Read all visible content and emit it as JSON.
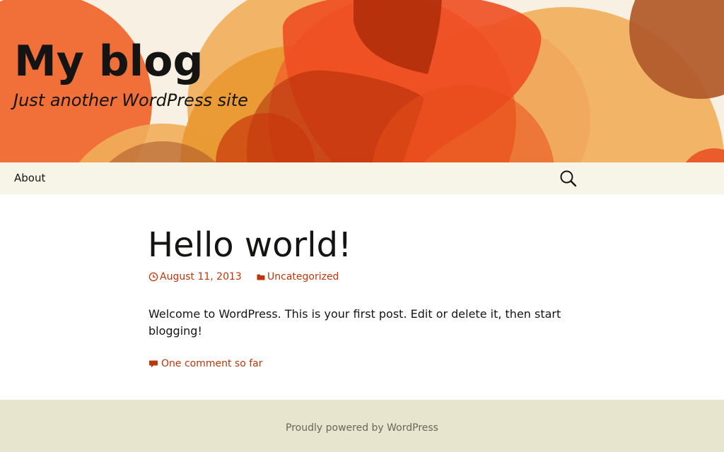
{
  "header": {
    "site_title": "My blog",
    "tagline": "Just another WordPress site",
    "art_palette": [
      "#f8f1e3",
      "#f0652b",
      "#f1ae5a",
      "#e95225",
      "#ad2c08",
      "#b35c2c"
    ]
  },
  "nav": {
    "items": [
      {
        "label": "About"
      }
    ],
    "search_icon": "search-icon"
  },
  "post": {
    "title": "Hello world!",
    "date": "August 11, 2013",
    "date_icon": "clock-icon",
    "category": "Uncategorized",
    "category_icon": "folder-icon",
    "content": "Welcome to WordPress. This is your first post. Edit or delete it, then start blogging!",
    "comments_link": "One comment so far",
    "comments_icon": "comment-bubble-icon"
  },
  "footer": {
    "credit": "Proudly powered by WordPress"
  },
  "colors": {
    "accent": "#bc360a",
    "text": "#141412",
    "nav_bg": "#f7f5e7",
    "footer_bg": "#e8e5ce",
    "footer_text": "#686758"
  }
}
